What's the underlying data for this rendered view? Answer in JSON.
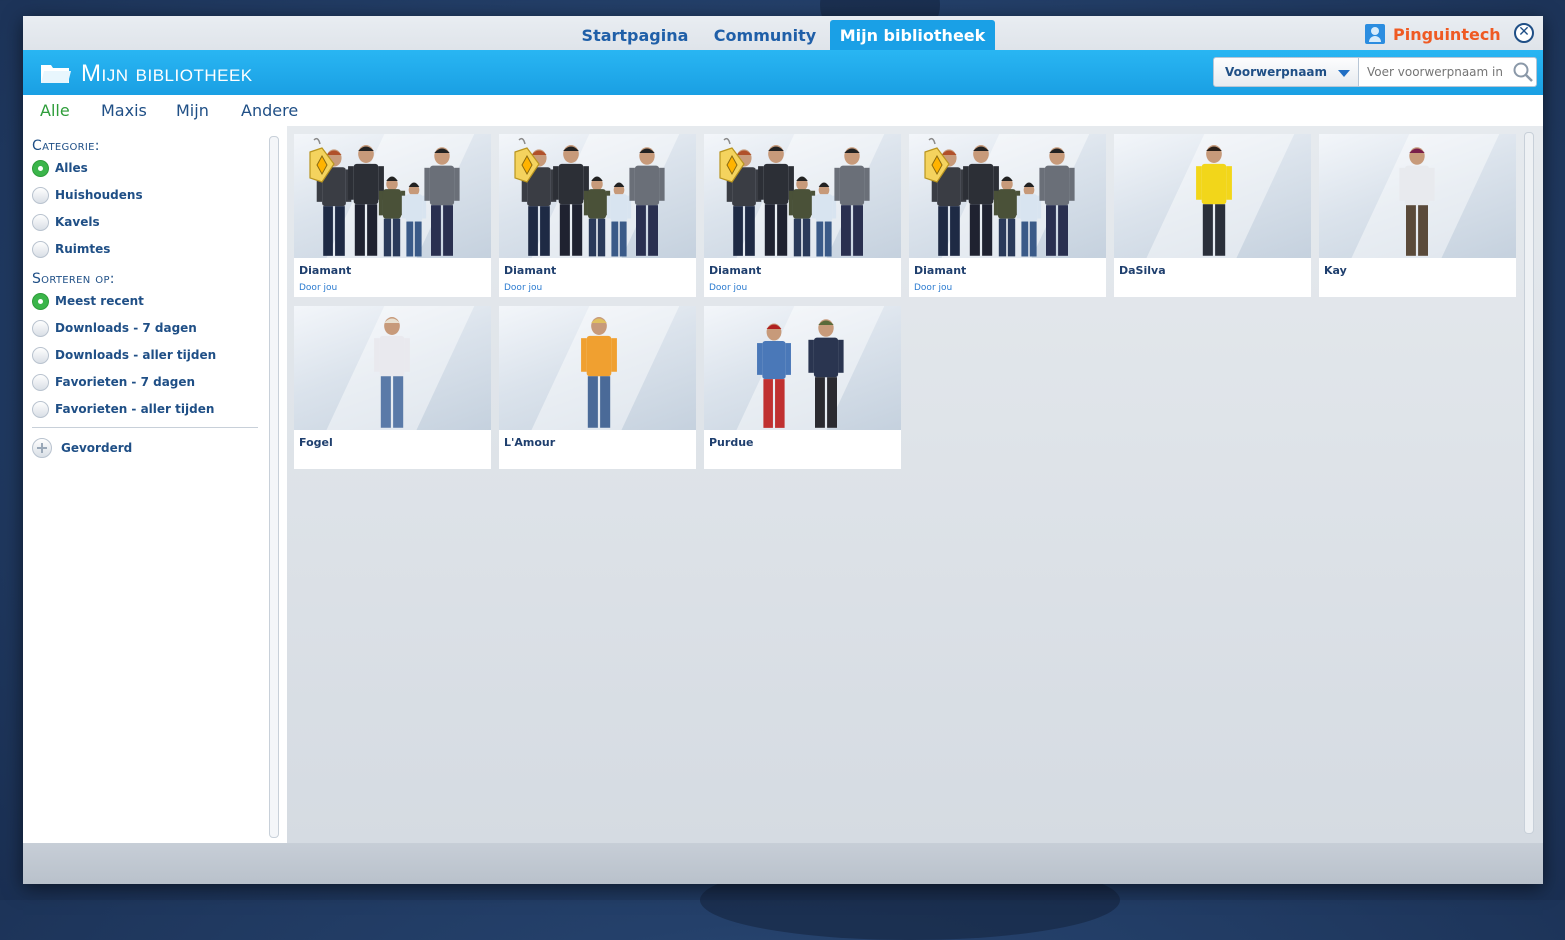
{
  "tabs": [
    {
      "label": "Startpagina",
      "active": false
    },
    {
      "label": "Community",
      "active": false
    },
    {
      "label": "Mijn bibliotheek",
      "active": true
    }
  ],
  "user": {
    "name": "Pinguintech"
  },
  "header": {
    "title": "Mijn bibliotheek"
  },
  "search": {
    "dropdown_value": "Voorwerpnaam",
    "placeholder": "Voer voorwerpnaam in"
  },
  "filters": [
    {
      "label": "Alle",
      "active": true
    },
    {
      "label": "Maxis",
      "active": false
    },
    {
      "label": "Mijn",
      "active": false
    },
    {
      "label": "Andere",
      "active": false
    }
  ],
  "sidebar": {
    "category_title": "Categorie:",
    "categories": [
      {
        "label": "Alles",
        "selected": true
      },
      {
        "label": "Huishoudens",
        "selected": false
      },
      {
        "label": "Kavels",
        "selected": false
      },
      {
        "label": "Ruimtes",
        "selected": false
      }
    ],
    "sort_title": "Sorteren op:",
    "sort_options": [
      {
        "label": "Meest recent",
        "selected": true
      },
      {
        "label": "Downloads - 7 dagen",
        "selected": false
      },
      {
        "label": "Downloads - aller tijden",
        "selected": false
      },
      {
        "label": "Favorieten - 7 dagen",
        "selected": false
      },
      {
        "label": "Favorieten - aller tijden",
        "selected": false
      }
    ],
    "advanced_label": "Gevorderd"
  },
  "items": [
    {
      "name": "Diamant",
      "author": "Door jou",
      "type": "household",
      "tagged": true
    },
    {
      "name": "Diamant",
      "author": "Door jou",
      "type": "household",
      "tagged": true
    },
    {
      "name": "Diamant",
      "author": "Door jou",
      "type": "household",
      "tagged": true
    },
    {
      "name": "Diamant",
      "author": "Door jou",
      "type": "household",
      "tagged": true
    },
    {
      "name": "DaSilva",
      "author": "",
      "type": "sim-man-yellow",
      "tagged": false
    },
    {
      "name": "Kay",
      "author": "",
      "type": "sim-woman-white",
      "tagged": false
    },
    {
      "name": "Fogel",
      "author": "",
      "type": "sim-man-raglan",
      "tagged": false
    },
    {
      "name": "L'Amour",
      "author": "",
      "type": "sim-woman-orange",
      "tagged": false
    },
    {
      "name": "Purdue",
      "author": "",
      "type": "sim-couple",
      "tagged": false
    }
  ],
  "colors": {
    "accent": "#1aa0e6",
    "link": "#1f4f86",
    "active_green": "#2e9d3a",
    "user_orange": "#ef5a23"
  }
}
